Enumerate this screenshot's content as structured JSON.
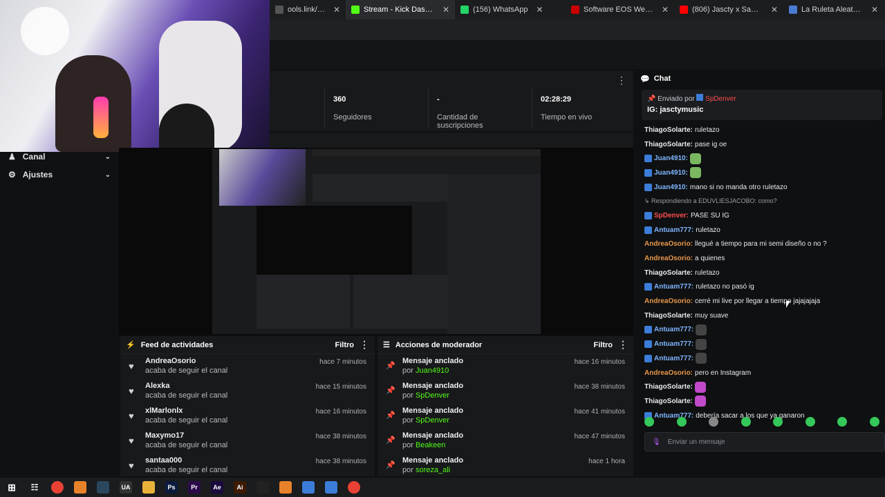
{
  "browser": {
    "tabs": [
      {
        "label": "ools.link/links/ableton-lin",
        "color": "#555"
      },
      {
        "label": "Stream - Kick Dashboard",
        "color": "#53fc18",
        "active": true
      },
      {
        "label": "(156) WhatsApp",
        "color": "#25d366"
      },
      {
        "label": "Software EOS Webcam Utility P",
        "color": "#c00"
      },
      {
        "label": "(806) Jascty x SantaM - Por Que",
        "color": "#f00"
      },
      {
        "label": "La Ruleta Aleatoria",
        "color": "#4a7bd1"
      }
    ]
  },
  "nav": {
    "items": [
      {
        "label": "Canal",
        "icon": "users-icon"
      },
      {
        "label": "Ajustes",
        "icon": "gear-icon"
      }
    ]
  },
  "stats": [
    {
      "value": "360",
      "label": "Seguidores"
    },
    {
      "value": "-",
      "label": "Cantidad de suscripciones"
    },
    {
      "value": "02:28:29",
      "label": "Tiempo en vivo"
    }
  ],
  "feed": {
    "title": "Feed de actividades",
    "filter": "Filtro",
    "rows": [
      {
        "name": "AndreaOsorio",
        "action": "acaba de seguir el canal",
        "time": "hace 7 minutos"
      },
      {
        "name": "Alexka",
        "action": "acaba de seguir el canal",
        "time": "hace 15 minutos"
      },
      {
        "name": "xlMarlonlx",
        "action": "acaba de seguir el canal",
        "time": "hace 16 minutos"
      },
      {
        "name": "Maxymo17",
        "action": "acaba de seguir el canal",
        "time": "hace 38 minutos"
      },
      {
        "name": "santaa000",
        "action": "acaba de seguir el canal",
        "time": "hace 38 minutos"
      }
    ]
  },
  "mod": {
    "title": "Acciones de moderador",
    "filter": "Filtro",
    "rows": [
      {
        "action": "Mensaje anclado",
        "by": "por",
        "user": "Juan4910",
        "time": "hace 16 minutos"
      },
      {
        "action": "Mensaje anclado",
        "by": "por",
        "user": "SpDenver",
        "time": "hace 38 minutos"
      },
      {
        "action": "Mensaje anclado",
        "by": "por",
        "user": "SpDenver",
        "time": "hace 41 minutos"
      },
      {
        "action": "Mensaje anclado",
        "by": "por",
        "user": "Beakeen",
        "time": "hace 47 minutos"
      },
      {
        "action": "Mensaje anclado",
        "by": "por",
        "user": "soreza_ali",
        "time": "hace 1 hora"
      }
    ]
  },
  "chat": {
    "title": "Chat",
    "pinned_by_label": "Enviado por",
    "pinned_by_user": "SpDenver",
    "pinned_message": "IG: jasctymusic",
    "messages": [
      {
        "user": "ThiagoSolarte",
        "text": "ruletazo",
        "color": "#e8eaed",
        "badge": false
      },
      {
        "user": "ThiagoSolarte",
        "text": "pase ig oe",
        "color": "#e8eaed",
        "badge": false
      },
      {
        "user": "Juan4910",
        "text": "",
        "color": "#7fb5ff",
        "badge": true,
        "emote": "#7bb661"
      },
      {
        "user": "Juan4910",
        "text": "",
        "color": "#7fb5ff",
        "badge": true,
        "emote": "#7bb661"
      },
      {
        "user": "Juan4910",
        "text": "mano si no manda otro ruletazo",
        "color": "#7fb5ff",
        "badge": true
      },
      {
        "reply": "Respondiendo a EDUVLIESJACOBO: como?"
      },
      {
        "user": "SpDenver",
        "text": "PASE SU IG",
        "color": "#ff4d4d",
        "badge": true
      },
      {
        "user": "Antuam777",
        "text": "ruletazo",
        "color": "#7fb5ff",
        "badge": true
      },
      {
        "user": "AndreaOsorio",
        "text": "llegué a tiempo para mi semi diseño o no ?",
        "color": "#e8974a",
        "badge": false
      },
      {
        "user": "AndreaOsorio",
        "text": "a quienes",
        "color": "#e8974a",
        "badge": false
      },
      {
        "user": "ThiagoSolarte",
        "text": "ruletazo",
        "color": "#e8eaed",
        "badge": false
      },
      {
        "user": "Antuam777",
        "text": "ruletazo no pasó ig",
        "color": "#7fb5ff",
        "badge": true
      },
      {
        "user": "AndreaOsorio",
        "text": "cerré mi live por llegar a tiempo jajajajaja",
        "color": "#e8974a",
        "badge": false
      },
      {
        "user": "ThiagoSolarte",
        "text": "muy suave",
        "color": "#e8eaed",
        "badge": false
      },
      {
        "user": "Antuam777",
        "text": "",
        "color": "#7fb5ff",
        "badge": true,
        "emote": "#444"
      },
      {
        "user": "Antuam777",
        "text": "",
        "color": "#7fb5ff",
        "badge": true,
        "emote": "#444"
      },
      {
        "user": "Antuam777",
        "text": "",
        "color": "#7fb5ff",
        "badge": true,
        "emote": "#444"
      },
      {
        "user": "AndreaOsorio",
        "text": "pero en Instagram",
        "color": "#e8974a",
        "badge": false
      },
      {
        "user": "ThiagoSolarte",
        "text": "",
        "color": "#e8eaed",
        "badge": false,
        "emote": "#c04ac9"
      },
      {
        "user": "ThiagoSolarte",
        "text": "",
        "color": "#e8eaed",
        "badge": false,
        "emote": "#c04ac9"
      },
      {
        "user": "Antuam777",
        "text": "debería sacar a los que ya ganaron",
        "color": "#7fb5ff",
        "badge": true
      }
    ],
    "input_placeholder": "Enviar un mensaje"
  },
  "taskbar": {
    "apps": [
      {
        "name": "windows-icon",
        "label": "",
        "color": "#1b1c1e"
      },
      {
        "name": "taskview-icon",
        "label": "",
        "color": "#1b1c1e"
      },
      {
        "name": "chrome-icon",
        "label": "",
        "color": "#e94235"
      },
      {
        "name": "app-icon",
        "label": "",
        "color": "#e8822a"
      },
      {
        "name": "steam-icon",
        "label": "",
        "color": "#2a475e"
      },
      {
        "name": "ua-icon",
        "label": "UA",
        "color": "#333"
      },
      {
        "name": "folder-icon",
        "label": "",
        "color": "#e8b23a"
      },
      {
        "name": "photoshop-icon",
        "label": "Ps",
        "color": "#0a1b3d"
      },
      {
        "name": "premiere-icon",
        "label": "Pr",
        "color": "#2a0a4a"
      },
      {
        "name": "aftereffects-icon",
        "label": "Ae",
        "color": "#1a0a3d"
      },
      {
        "name": "illustrator-icon",
        "label": "Ai",
        "color": "#3d1a00"
      },
      {
        "name": "obs-icon",
        "label": "",
        "color": "#222"
      },
      {
        "name": "app2-icon",
        "label": "",
        "color": "#e8822a"
      },
      {
        "name": "kick-icon",
        "label": "",
        "color": "#3b7dd8"
      },
      {
        "name": "kick2-icon",
        "label": "",
        "color": "#3b7dd8"
      },
      {
        "name": "chrome2-icon",
        "label": "",
        "color": "#e94235"
      }
    ]
  }
}
